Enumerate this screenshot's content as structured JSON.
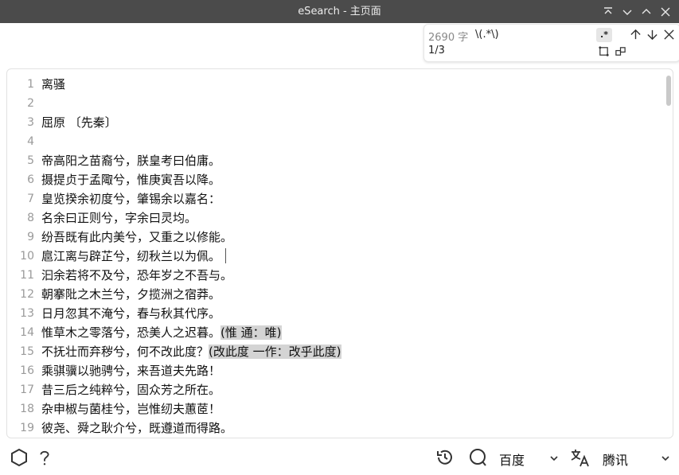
{
  "window": {
    "title": "eSearch - 主页面"
  },
  "find": {
    "char_count": "2690 字",
    "query": "\\(.*\\)",
    "match_index": "1/3",
    "regex_badge": ".*"
  },
  "editor": {
    "lines": [
      {
        "num": "1",
        "text": "离骚"
      },
      {
        "num": "2",
        "text": ""
      },
      {
        "num": "3",
        "text": "屈原 〔先秦〕"
      },
      {
        "num": "4",
        "text": ""
      },
      {
        "num": "5",
        "text": "帝高阳之苗裔兮，朕皇考曰伯庸。"
      },
      {
        "num": "6",
        "text": "摄提贞于孟陬兮，惟庚寅吾以降。"
      },
      {
        "num": "7",
        "text": "皇览揆余初度兮，肇锡余以嘉名："
      },
      {
        "num": "8",
        "text": "名余曰正则兮，字余曰灵均。"
      },
      {
        "num": "9",
        "text": "纷吾既有此内美兮，又重之以修能。"
      },
      {
        "num": "10",
        "text": "扈江离与辟芷兮，纫秋兰以为佩。"
      },
      {
        "num": "11",
        "text": "汩余若将不及兮，恐年岁之不吾与。"
      },
      {
        "num": "12",
        "text": "朝搴阰之木兰兮，夕揽洲之宿莽。"
      },
      {
        "num": "13",
        "text": "日月忽其不淹兮，春与秋其代序。"
      },
      {
        "num": "14",
        "text": "惟草木之零落兮，恐美人之迟暮。",
        "hl": "(惟 通：唯)"
      },
      {
        "num": "15",
        "text": "不抚壮而弃秽兮，何不改此度？",
        "hl": "(改此度 一作：改乎此度)"
      },
      {
        "num": "16",
        "text": "乘骐骥以驰骋兮，来吾道夫先路！"
      },
      {
        "num": "17",
        "text": "昔三后之纯粹兮，固众芳之所在。"
      },
      {
        "num": "18",
        "text": "杂申椒与菌桂兮，岂惟纫夫蕙茝！"
      },
      {
        "num": "19",
        "text": "彼尧、舜之耿介兮，既遵道而得路。"
      }
    ]
  },
  "bottombar": {
    "search_engine": "百度",
    "translate_engine": "腾讯"
  },
  "colors": {
    "titlebar_bg": "#4b4b4b",
    "highlight": "#d4d4d4",
    "line_number": "#9a9a9a"
  }
}
